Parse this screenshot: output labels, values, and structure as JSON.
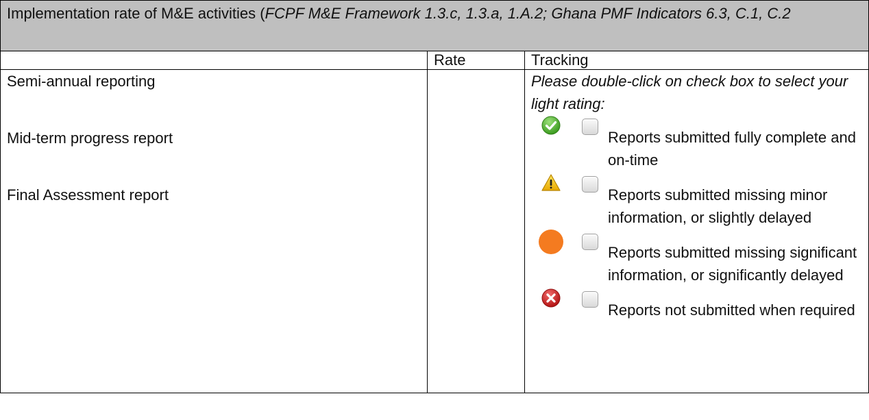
{
  "header": {
    "title_plain": "Implementation rate of M&E activities (",
    "title_italic": "FCPF M&E Framework 1.3.c, 1.3.a, 1.A.2; Ghana PMF Indicators 6.3, C.1, C.2"
  },
  "columns": {
    "first": "",
    "rate": "Rate",
    "tracking": "Tracking"
  },
  "items": [
    "Semi-annual reporting",
    "Mid-term progress report",
    "Final Assessment report"
  ],
  "rate_value": "",
  "tracking": {
    "instruction": "Please double-click on check box to select your light rating:",
    "options": [
      {
        "icon": "green-check-icon",
        "label": "Reports submitted fully complete and on-time",
        "checked": false
      },
      {
        "icon": "yellow-warning-icon",
        "label": "Reports submitted missing minor information, or slightly delayed",
        "checked": false
      },
      {
        "icon": "orange-circle-icon",
        "label": "Reports submitted missing significant information, or significantly delayed",
        "checked": false
      },
      {
        "icon": "red-x-icon",
        "label": "Reports not submitted when required",
        "checked": false
      }
    ]
  },
  "colors": {
    "header_bg": "#bfbfbf",
    "green": "#4caf2e",
    "yellow": "#f2c500",
    "orange": "#f47b20",
    "red": "#d22b2b"
  }
}
